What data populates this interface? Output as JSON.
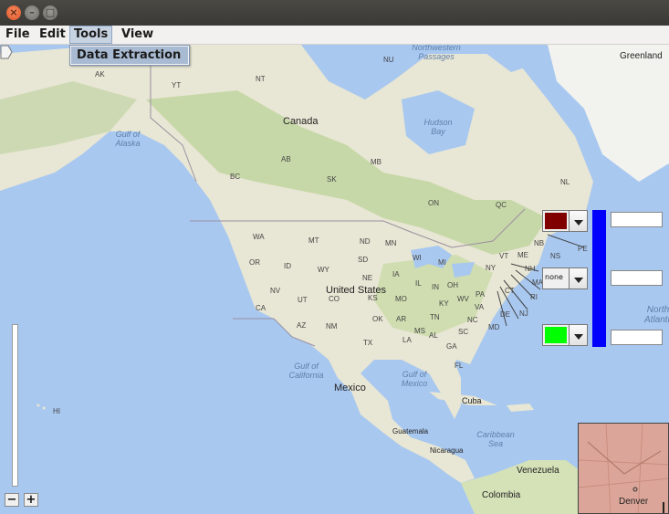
{
  "window": {
    "title": ""
  },
  "menubar": {
    "items": [
      {
        "label": "File"
      },
      {
        "label": "Edit"
      },
      {
        "label": "Tools"
      },
      {
        "label": "View"
      }
    ]
  },
  "tools_menu": {
    "items": [
      {
        "label": "Data Extraction"
      }
    ]
  },
  "map_labels": {
    "countries": [
      "Canada",
      "United States",
      "Mexico",
      "Greenland",
      "Cuba",
      "Venezuela",
      "Colombia",
      "Guatemala",
      "Nicaragua"
    ],
    "water": [
      "Gulf of Alaska",
      "Hudson Bay",
      "Gulf of California",
      "Gulf of Mexico",
      "Caribbean Sea",
      "Northwestern Passages",
      "North Atlantic"
    ],
    "provinces": [
      "AK",
      "YT",
      "NT",
      "NU",
      "BC",
      "AB",
      "SK",
      "MB",
      "ON",
      "QC",
      "NL",
      "NB",
      "NS",
      "PE"
    ],
    "states": [
      "WA",
      "OR",
      "CA",
      "NV",
      "ID",
      "MT",
      "WY",
      "UT",
      "AZ",
      "CO",
      "NM",
      "ND",
      "SD",
      "NE",
      "KS",
      "OK",
      "TX",
      "MN",
      "IA",
      "MO",
      "AR",
      "LA",
      "WI",
      "IL",
      "MI",
      "IN",
      "OH",
      "KY",
      "TN",
      "MS",
      "AL",
      "GA",
      "FL",
      "SC",
      "NC",
      "VA",
      "WV",
      "PA",
      "NY",
      "VT",
      "ME",
      "NH",
      "MA",
      "CT",
      "RI",
      "NJ",
      "DE",
      "MD",
      "HI"
    ],
    "cities": [
      "Denver"
    ]
  },
  "controls": {
    "swatch1": {
      "color": "#800000"
    },
    "swatch2": {
      "label": "none"
    },
    "swatch3": {
      "color": "#00ff00"
    },
    "bar_color": "#0000ff",
    "field1": "",
    "field2": "",
    "field3": ""
  },
  "zoom": {
    "minus": "−",
    "plus": "+"
  },
  "colors": {
    "water": "#a8c8f0",
    "land": "#e8e6d4",
    "forest": "#c7d8a8",
    "menu_highlight": "#a9bbd3"
  }
}
